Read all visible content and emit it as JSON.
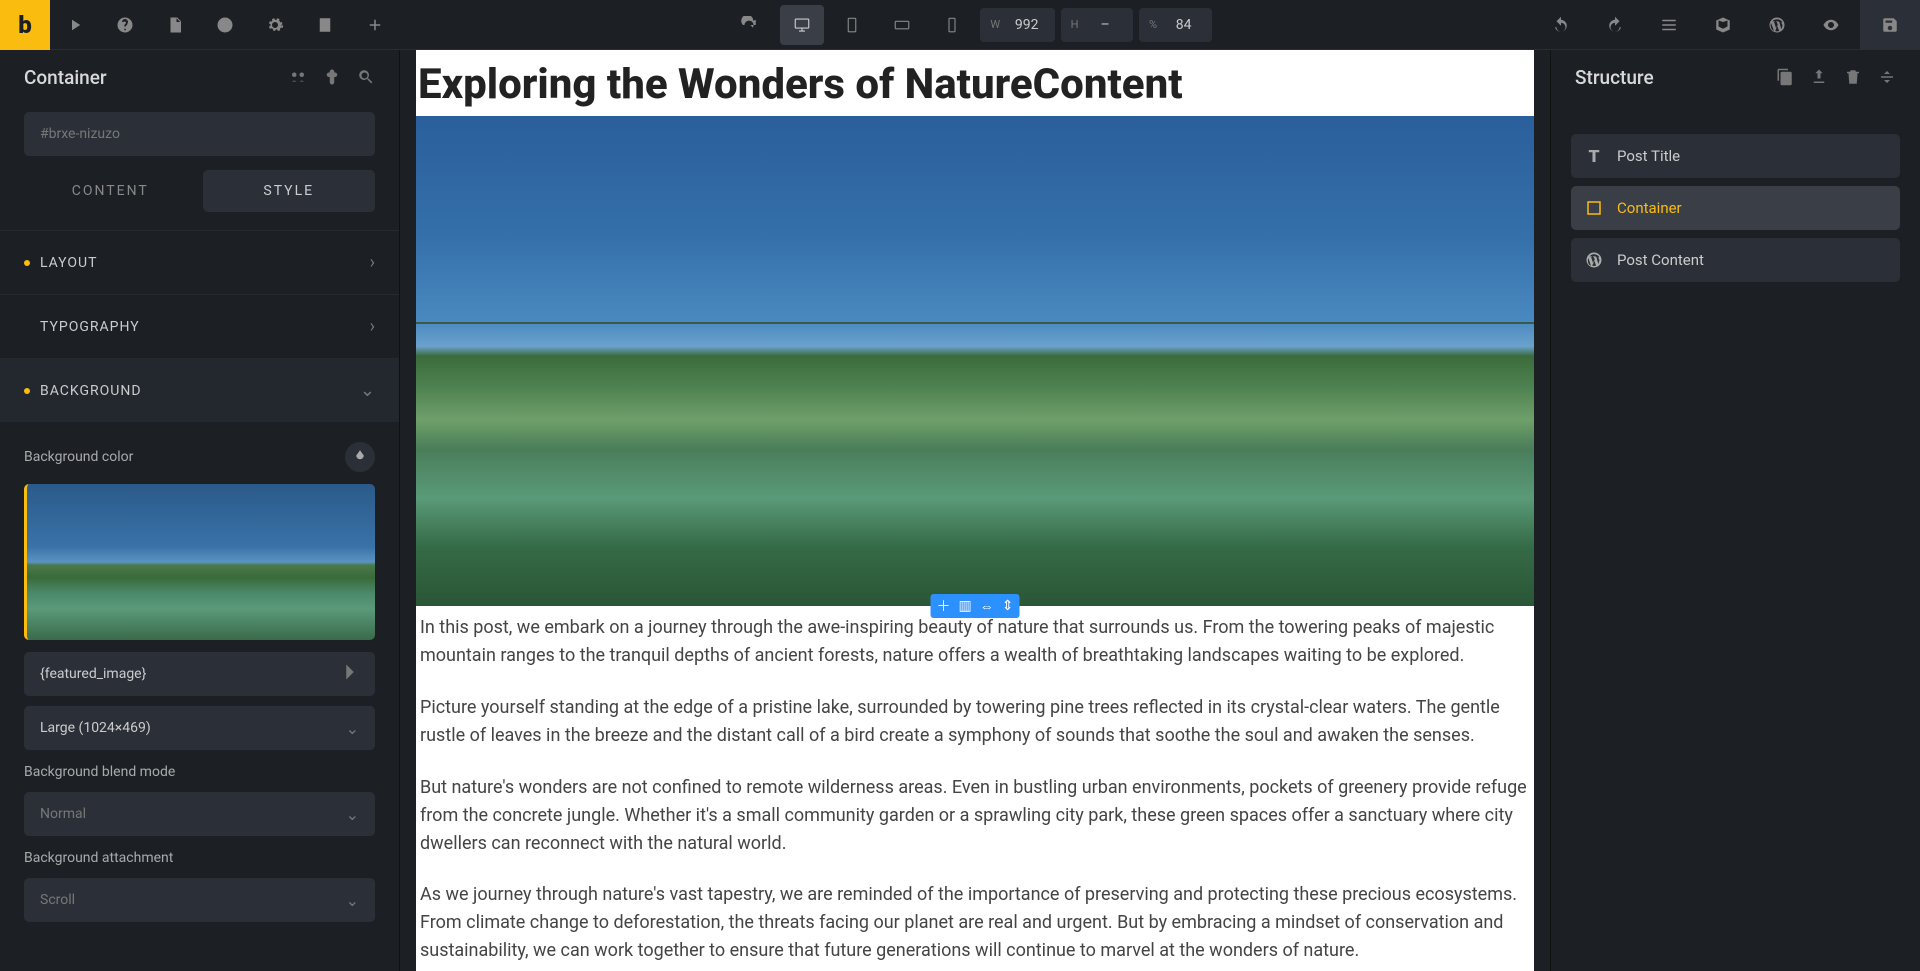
{
  "toolbar": {
    "dimensions": {
      "w_label": "W",
      "w_value": "992",
      "h_label": "H",
      "h_value": "–",
      "pct_label": "%",
      "pct_value": "84"
    }
  },
  "left_panel": {
    "title": "Container",
    "search_placeholder": "#brxe-nizuzo",
    "tabs": {
      "content": "CONTENT",
      "style": "STYLE"
    },
    "accordions": {
      "layout": "LAYOUT",
      "typography": "TYPOGRAPHY",
      "background": "BACKGROUND"
    },
    "background": {
      "color_label": "Background color",
      "image_value": "{featured_image}",
      "size_value": "Large (1024×469)",
      "blend_label": "Background blend mode",
      "blend_value": "Normal",
      "attach_label": "Background attachment",
      "attach_value": "Scroll"
    }
  },
  "canvas": {
    "title": "Exploring the Wonders of NatureContent",
    "p1": "In this post, we embark on a journey through the awe-inspiring beauty of nature that surrounds us. From the towering peaks of majestic mountain ranges to the tranquil depths of ancient forests, nature offers a wealth of breathtaking landscapes waiting to be explored.",
    "p2": "Picture yourself standing at the edge of a pristine lake, surrounded by towering pine trees reflected in its crystal-clear waters. The gentle rustle of leaves in the breeze and the distant call of a bird create a symphony of sounds that soothe the soul and awaken the senses.",
    "p3": "But nature's wonders are not confined to remote wilderness areas. Even in bustling urban environments, pockets of greenery provide refuge from the concrete jungle. Whether it's a small community garden or a sprawling city park, these green spaces offer a sanctuary where city dwellers can reconnect with the natural world.",
    "p4": "As we journey through nature's vast tapestry, we are reminded of the importance of preserving and protecting these precious ecosystems. From climate change to deforestation, the threats facing our planet are real and urgent. But by embracing a mindset of conservation and sustainability, we can work together to ensure that future generations will continue to marvel at the wonders of nature."
  },
  "right_panel": {
    "title": "Structure",
    "items": [
      {
        "label": "Post Title",
        "icon": "text"
      },
      {
        "label": "Container",
        "icon": "container",
        "active": true
      },
      {
        "label": "Post Content",
        "icon": "wordpress"
      }
    ]
  }
}
